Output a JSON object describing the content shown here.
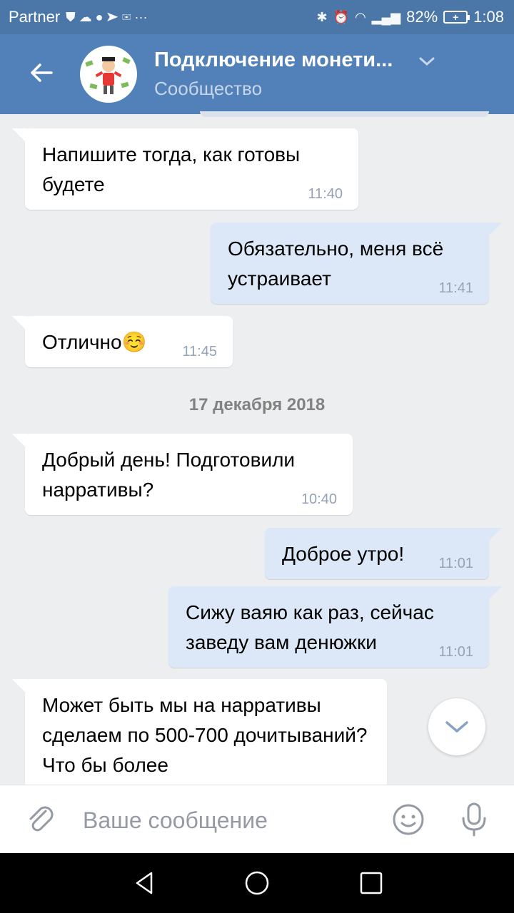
{
  "status_bar": {
    "carrier": "Partner",
    "battery": "82%",
    "time": "1:08"
  },
  "header": {
    "title": "Подключение монети...",
    "subtitle": "Сообщество"
  },
  "messages": [
    {
      "type": "incoming",
      "text": "Напишите тогда, как готовы будете",
      "time": "11:40"
    },
    {
      "type": "outgoing",
      "text": "Обязательно, меня всё устраивает",
      "time": "11:41"
    },
    {
      "type": "incoming",
      "text": "Отлично",
      "emoji": "☺️",
      "time": "11:45"
    },
    {
      "type": "outgoing",
      "text": "Доброе утро!",
      "time": "11:01"
    },
    {
      "type": "outgoing",
      "text": "Сижу ваяю как раз, сейчас заведу вам денюжки",
      "time": "11:01"
    },
    {
      "type": "incoming",
      "text": "Добрый день! Подготовили нарративы?",
      "time": "10:40"
    },
    {
      "type": "incoming",
      "text": "Может быть мы на нарративы сделаем по 500-700 дочитываний? Что бы более",
      "time": ""
    }
  ],
  "date_separator": "17 декабря 2018",
  "composer": {
    "placeholder": "Ваше сообщение"
  },
  "colors": {
    "header": "#5181b8",
    "status_bar": "#4a76a8",
    "incoming_bubble": "#ffffff",
    "outgoing_bubble": "#dce8f7",
    "chat_bg": "#edeef0"
  },
  "icons": [
    "back-arrow-icon",
    "chevron-down-icon",
    "attach-icon",
    "smile-icon",
    "mic-icon",
    "scroll-down-icon",
    "nav-back-icon",
    "nav-home-icon",
    "nav-recents-icon"
  ]
}
